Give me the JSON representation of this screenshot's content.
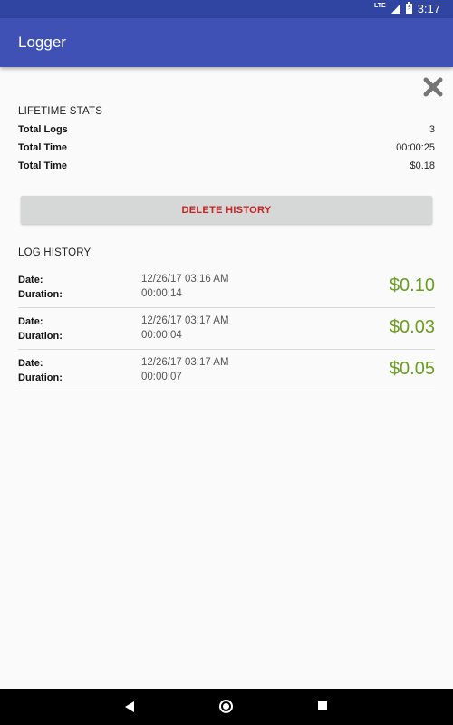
{
  "status_bar": {
    "network": "LTE",
    "battery_icon": "battery-icon",
    "time": "3:17"
  },
  "app_bar": {
    "title": "Logger",
    "color": "#3f51b5"
  },
  "close_icon": "close-icon",
  "lifetime_stats": {
    "title": "LIFETIME STATS",
    "rows": [
      {
        "label": "Total Logs",
        "value": "3"
      },
      {
        "label": "Total Time",
        "value": "00:00:25"
      },
      {
        "label": "Total Time",
        "value": "$0.18"
      }
    ]
  },
  "delete_button": {
    "label": "DELETE HISTORY",
    "color": "#c8211f"
  },
  "log_history": {
    "title": "LOG HISTORY",
    "date_label": "Date:",
    "duration_label": "Duration:",
    "cost_color": "#6a9e1f",
    "items": [
      {
        "date": "12/26/17 03:16 AM",
        "duration": "00:00:14",
        "cost": "$0.10"
      },
      {
        "date": "12/26/17 03:17 AM",
        "duration": "00:00:04",
        "cost": "$0.03"
      },
      {
        "date": "12/26/17 03:17 AM",
        "duration": "00:00:07",
        "cost": "$0.05"
      }
    ]
  },
  "nav_bar": {
    "back_icon": "back-icon",
    "home_icon": "home-icon",
    "recents_icon": "recents-icon"
  }
}
